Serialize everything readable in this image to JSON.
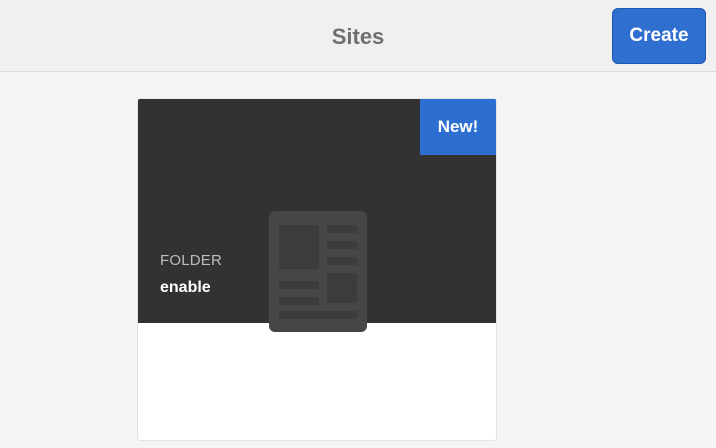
{
  "header": {
    "title": "Sites",
    "create_label": "Create"
  },
  "card": {
    "badge": "New!",
    "type_label": "FOLDER",
    "name": "enable",
    "thumbnail_icon": "page-layout-icon"
  },
  "colors": {
    "accent": "#2f6fd0",
    "card_dark": "#323232",
    "background": "#f4f4f4"
  }
}
